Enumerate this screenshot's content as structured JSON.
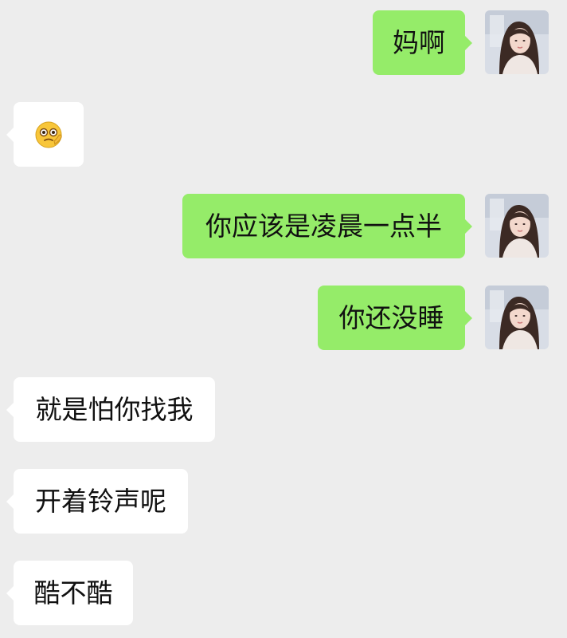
{
  "conversation": {
    "messages": [
      {
        "side": "out",
        "text": "妈啊"
      },
      {
        "side": "in",
        "emoji": "nervous-face-waving-emoji"
      },
      {
        "side": "out",
        "text": "你应该是凌晨一点半"
      },
      {
        "side": "out",
        "text": "你还没睡"
      },
      {
        "side": "in",
        "text": "就是怕你找我"
      },
      {
        "side": "in",
        "text": "开着铃声呢"
      },
      {
        "side": "in",
        "text": "酷不酷"
      }
    ]
  },
  "colors": {
    "background": "#ededed",
    "outgoing_bubble": "#95ec69",
    "incoming_bubble": "#ffffff",
    "text": "#111111"
  },
  "icons": {
    "self_avatar": "user-avatar-photo",
    "emoji": "nervous-face-waving-emoji"
  }
}
